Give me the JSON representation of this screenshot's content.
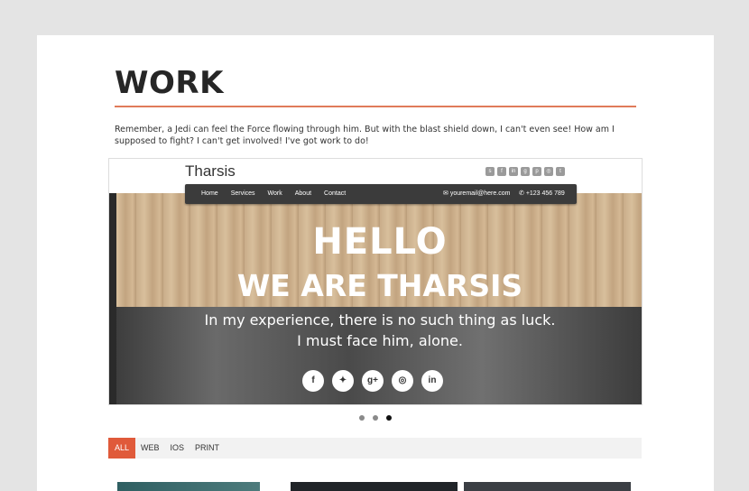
{
  "page": {
    "title": "WORK",
    "intro": "Remember, a Jedi can feel the Force flowing through him. But with the blast shield down, I can't even see! How am I supposed to fight? I can't get involved! I've got work to do!"
  },
  "slider": {
    "site_logo": "Tharsis",
    "nav_links": [
      "Home",
      "Services",
      "Work",
      "About",
      "Contact"
    ],
    "email": "youremail@here.com",
    "phone": "+123 456 789",
    "hero_line1": "HELLO",
    "hero_line2": "WE ARE THARSIS",
    "sub_line1": "In my experience, there is no such thing as luck.",
    "sub_line2": "I must face him, alone.",
    "header_social_icons": [
      "skype-icon",
      "facebook-icon",
      "linkedin-icon",
      "google-plus-icon",
      "pinterest-icon",
      "dribbble-icon",
      "twitter-icon"
    ],
    "social_icons": [
      "facebook-icon",
      "twitter-icon",
      "google-plus-icon",
      "dribbble-icon",
      "linkedin-icon"
    ],
    "active_slide": 3,
    "slide_count": 3
  },
  "filters": {
    "items": [
      "ALL",
      "WEB",
      "IOS",
      "PRINT"
    ],
    "active": "ALL"
  },
  "colors": {
    "accent": "#e05a3a",
    "rule": "#e07b5a",
    "page_bg": "#e4e4e4"
  }
}
